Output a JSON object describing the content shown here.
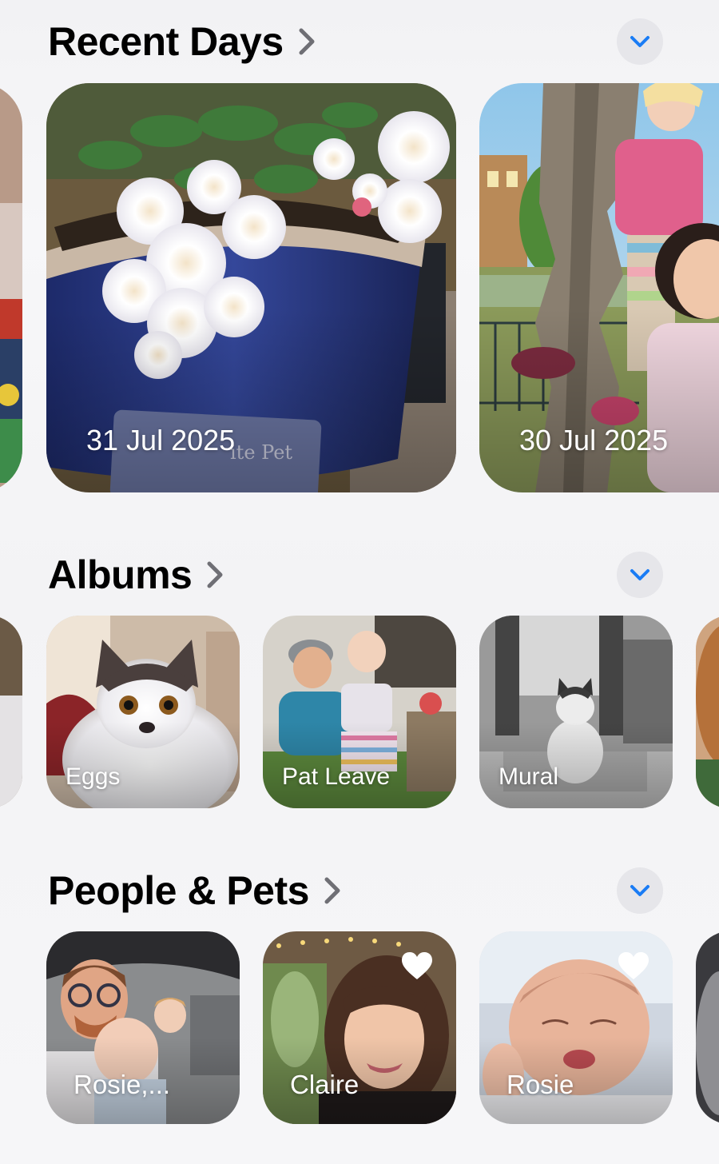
{
  "sections": {
    "recent_days": {
      "title": "Recent Days",
      "cards": [
        {
          "label": "31 Jul 2025"
        },
        {
          "label": "30 Jul 2025"
        }
      ]
    },
    "albums": {
      "title": "Albums",
      "cards": [
        {
          "label": "Eggs"
        },
        {
          "label": "Pat Leave"
        },
        {
          "label": "Mural"
        }
      ]
    },
    "people_pets": {
      "title": "People & Pets",
      "cards": [
        {
          "label": "Rosie,...",
          "favorite": false
        },
        {
          "label": "Claire",
          "favorite": true
        },
        {
          "label": "Rosie",
          "favorite": true
        }
      ]
    }
  },
  "icons": {
    "section_chevron": "chevron-right-icon",
    "collapse": "chevron-down-icon",
    "favorite": "heart-icon"
  },
  "colors": {
    "accent": "#1a7cf5",
    "chevron_gray": "#7a7a80",
    "button_bg": "#e6e6ea"
  }
}
